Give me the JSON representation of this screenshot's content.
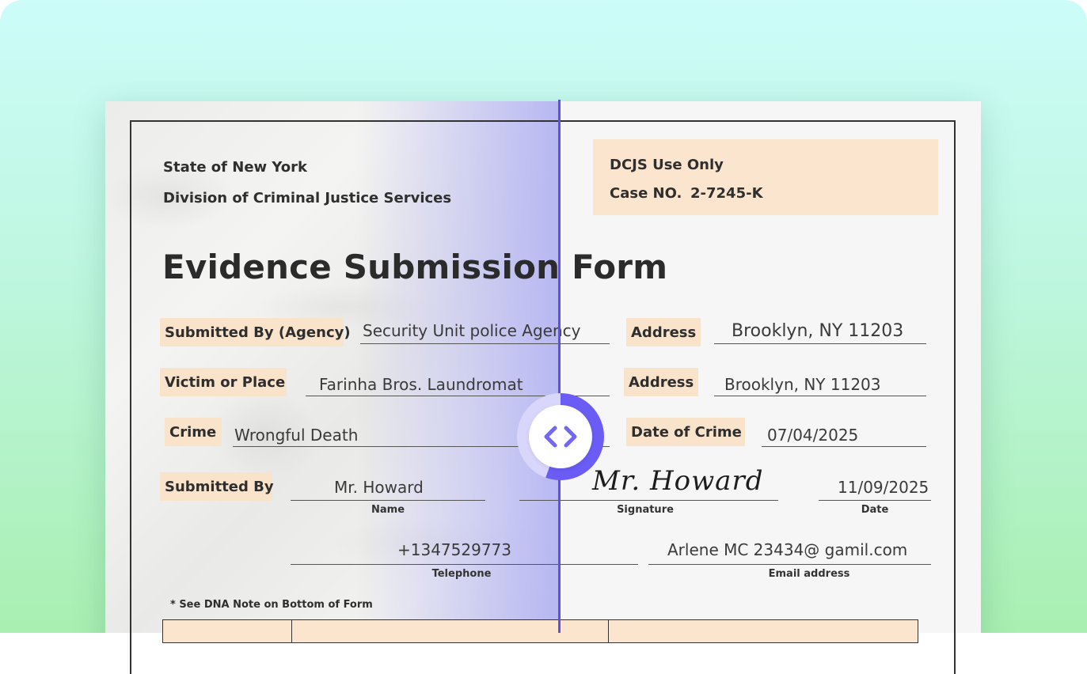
{
  "header": {
    "state": "State of New York",
    "division": "Division of Criminal Justice Services"
  },
  "dcjs_box": {
    "label": "DCJS Use Only",
    "case_label": "Case NO.",
    "case_number": "2-7245-K"
  },
  "title": "Evidence Submission Form",
  "fields": {
    "agency_label": "Submitted By (Agency)",
    "agency_value": "Security Unit police Agency",
    "address1_label": "Address",
    "address1_value": "Brooklyn, NY 11203",
    "victim_label": "Victim or Place",
    "victim_value": "Farinha Bros. Laundromat",
    "address2_label": "Address",
    "address2_value": "Brooklyn, NY 11203",
    "crime_label": "Crime",
    "crime_value": "Wrongful Death",
    "date_crime_label": "Date of Crime",
    "date_crime_value": "07/04/2025",
    "submitted_by_label": "Submitted By",
    "name_value": "Mr. Howard",
    "name_caption": "Name",
    "signature_value": "Mr. Howard",
    "signature_caption": "Signature",
    "date_value": "11/09/2025",
    "date_caption": "Date",
    "telephone_value": "+1347529773",
    "telephone_caption": "Telephone",
    "email_value": "Arlene MC 23434@ gamil.com",
    "email_caption": "Email address"
  },
  "note": "* See DNA Note on Bottom of Form",
  "colors": {
    "accent": "#5b4ff0",
    "tag_bg": "#f9e3cb",
    "background_top": "#cdfcf9",
    "background_bottom": "#a9efb1"
  },
  "icons": {
    "compare_handle": "chevron-left-right-icon"
  }
}
